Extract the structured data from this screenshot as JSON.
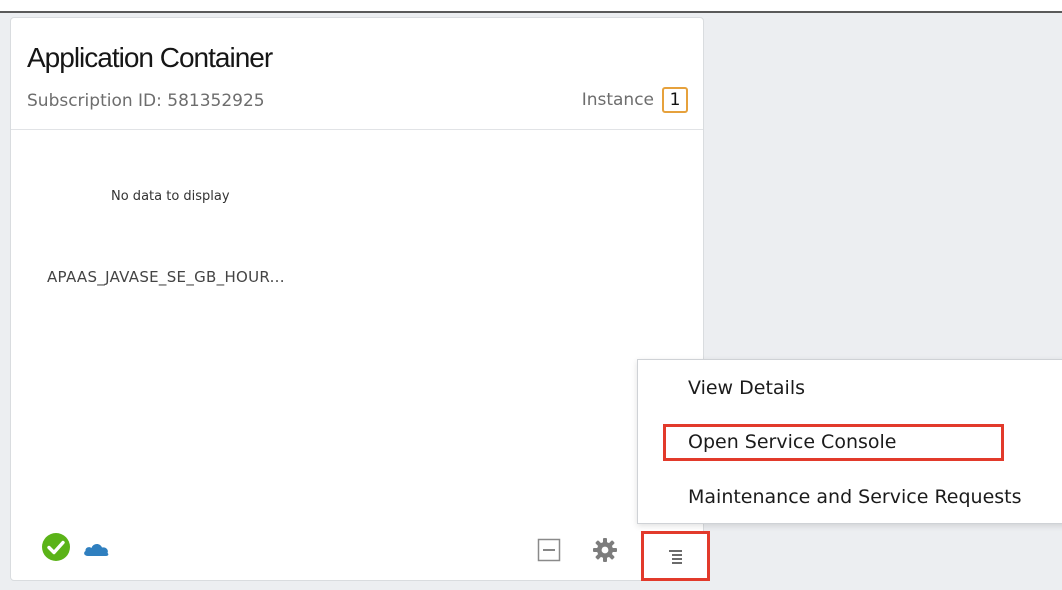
{
  "card": {
    "title": "Application Container",
    "subscription_id": "Subscription ID: 581352925",
    "instance_label": "Instance",
    "instance_count": "1",
    "no_data_text": "No data to display",
    "plan_name": "APAAS_JAVASE_SE_GB_HOUR...",
    "status_icon": "check-circle-icon",
    "cloud_icon": "cloud-icon"
  },
  "footer": {
    "minimize_icon": "minimize-icon",
    "settings_icon": "gear-icon",
    "menu_icon": "hamburger-menu-icon"
  },
  "dropdown_menu": {
    "items": [
      {
        "label": "View Details"
      },
      {
        "label": "Open Service Console",
        "highlighted": true
      },
      {
        "label": "Maintenance and Service Requests"
      }
    ]
  },
  "colors": {
    "highlight": "#e23a2b",
    "instance_badge_border": "#e6a13c",
    "status_ok": "#5bb318",
    "cloud": "#2f7fbf",
    "background_panel": "#eceef1"
  }
}
